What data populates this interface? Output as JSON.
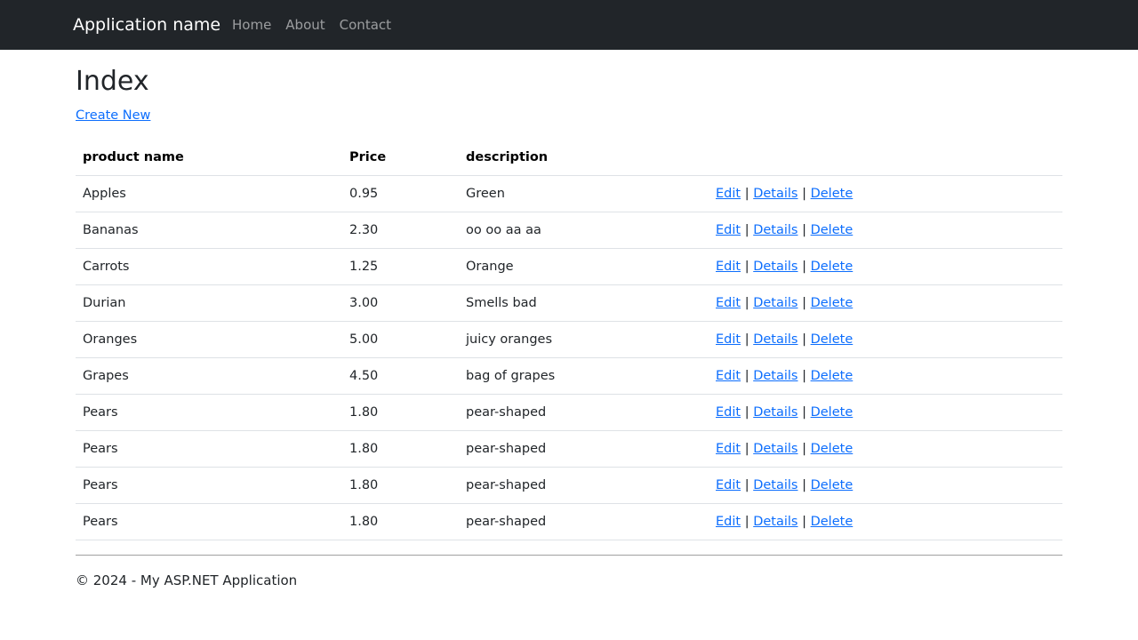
{
  "navbar": {
    "brand": "Application name",
    "links": [
      {
        "label": "Home"
      },
      {
        "label": "About"
      },
      {
        "label": "Contact"
      }
    ]
  },
  "page": {
    "title": "Index",
    "create_label": "Create New"
  },
  "table": {
    "headers": [
      "product name",
      "Price",
      "description",
      ""
    ],
    "action_labels": {
      "edit": "Edit",
      "details": "Details",
      "delete": "Delete",
      "separator": "|"
    },
    "rows": [
      {
        "name": "Apples",
        "price": "0.95",
        "description": "Green"
      },
      {
        "name": "Bananas",
        "price": "2.30",
        "description": "oo oo aa aa"
      },
      {
        "name": "Carrots",
        "price": "1.25",
        "description": "Orange"
      },
      {
        "name": "Durian",
        "price": "3.00",
        "description": "Smells bad"
      },
      {
        "name": "Oranges",
        "price": "5.00",
        "description": "juicy oranges"
      },
      {
        "name": "Grapes",
        "price": "4.50",
        "description": "bag of grapes"
      },
      {
        "name": "Pears",
        "price": "1.80",
        "description": "pear-shaped"
      },
      {
        "name": "Pears",
        "price": "1.80",
        "description": "pear-shaped"
      },
      {
        "name": "Pears",
        "price": "1.80",
        "description": "pear-shaped"
      },
      {
        "name": "Pears",
        "price": "1.80",
        "description": "pear-shaped"
      }
    ]
  },
  "footer": {
    "text": "© 2024 - My ASP.NET Application"
  },
  "colors": {
    "navbar_bg": "#212529",
    "link": "#0d6efd",
    "nav_link": "rgba(255,255,255,0.55)",
    "border": "#dee2e6"
  }
}
